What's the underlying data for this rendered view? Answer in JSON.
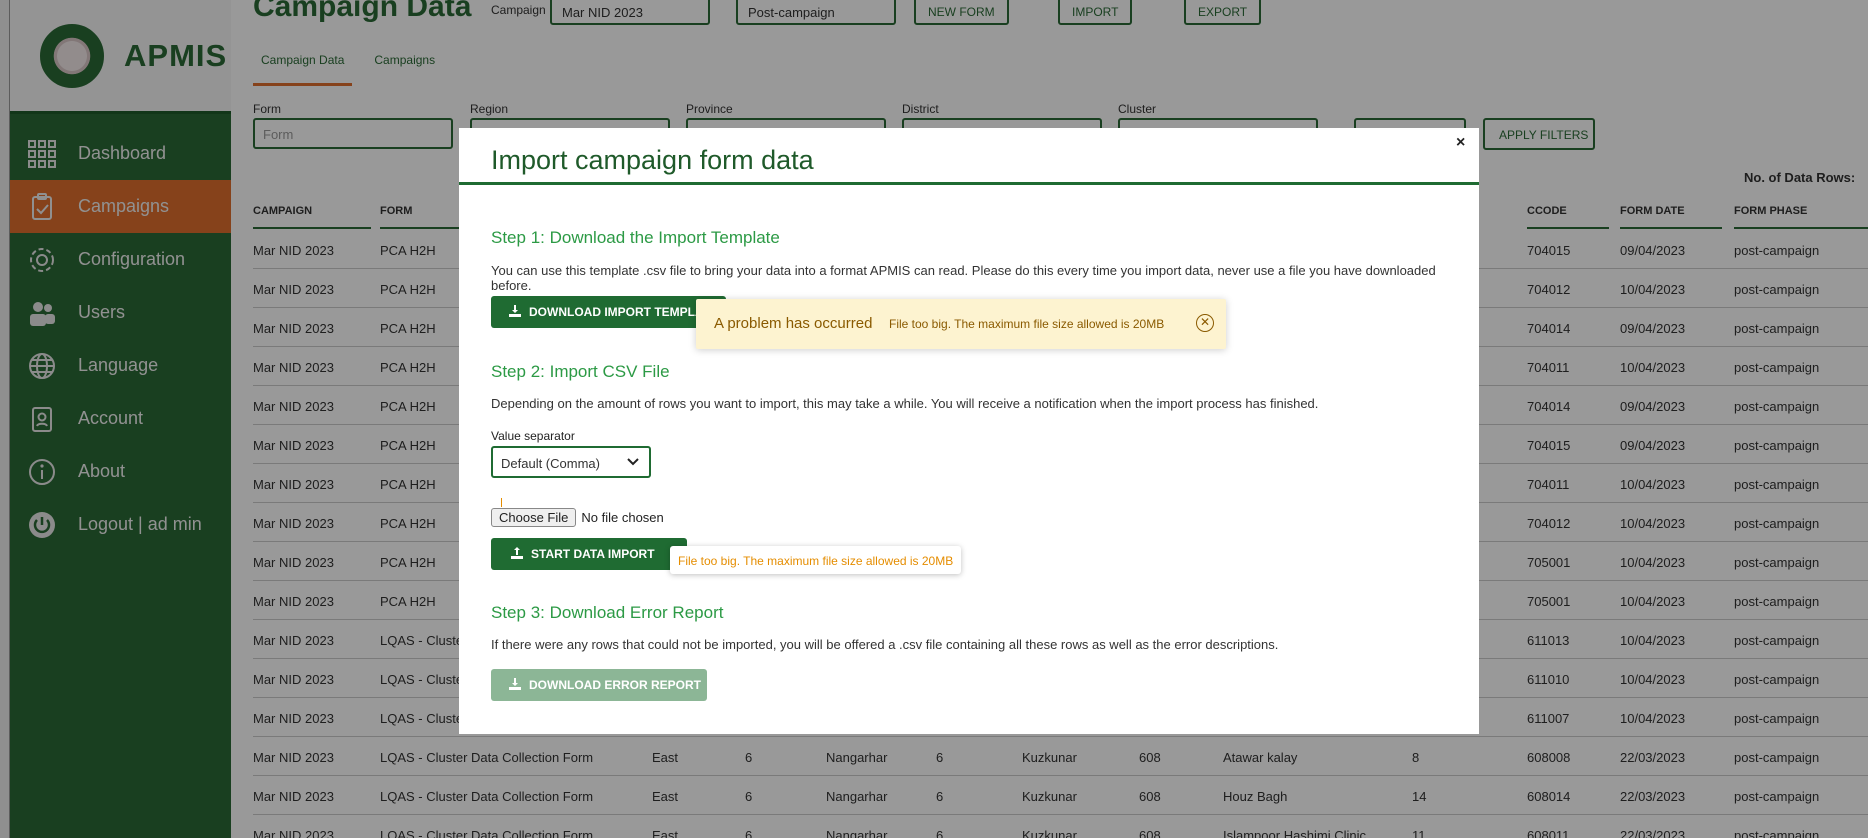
{
  "app": {
    "name": "APMIS"
  },
  "sidebar": {
    "items": [
      {
        "label": "Dashboard",
        "icon": "grid-icon"
      },
      {
        "label": "Campaigns",
        "icon": "clipboard-icon"
      },
      {
        "label": "Configuration",
        "icon": "gear-icon"
      },
      {
        "label": "Users",
        "icon": "users-icon"
      },
      {
        "label": "Language",
        "icon": "globe-icon"
      },
      {
        "label": "Account",
        "icon": "id-badge-icon"
      },
      {
        "label": "About",
        "icon": "info-icon"
      },
      {
        "label": "Logout | ad min",
        "icon": "power-icon"
      }
    ]
  },
  "header": {
    "title": "Campaign Data",
    "campaign_label": "Campaign",
    "campaign_value": "Mar NID 2023",
    "phase_value": "Post-campaign",
    "new_form": "NEW FORM",
    "import": "IMPORT",
    "export": "EXPORT"
  },
  "tabs": [
    "Campaign Data",
    "Campaigns"
  ],
  "filters": {
    "form_label": "Form",
    "form_placeholder": "Form",
    "region_label": "Region",
    "province_label": "Province",
    "district_label": "District",
    "cluster_label": "Cluster",
    "apply": "APPLY FILTERS",
    "rows_label": "No. of Data Rows:"
  },
  "table": {
    "headers": [
      "CAMPAIGN",
      "FORM",
      "CCODE",
      "FORM DATE",
      "FORM PHASE"
    ],
    "rows": [
      {
        "campaign": "Mar NID 2023",
        "form": "PCA H2H",
        "region": "",
        "rcode": "",
        "province": "",
        "pcode": "",
        "district": "",
        "dcode": "",
        "cluster": "",
        "clcode": "",
        "ccode": "704015",
        "date": "09/04/2023",
        "phase": "post-campaign"
      },
      {
        "campaign": "Mar NID 2023",
        "form": "PCA H2H",
        "region": "",
        "rcode": "",
        "province": "",
        "pcode": "",
        "district": "",
        "dcode": "",
        "cluster": "",
        "clcode": "",
        "ccode": "704012",
        "date": "10/04/2023",
        "phase": "post-campaign"
      },
      {
        "campaign": "Mar NID 2023",
        "form": "PCA H2H",
        "region": "",
        "rcode": "",
        "province": "",
        "pcode": "",
        "district": "",
        "dcode": "",
        "cluster": "",
        "clcode": "",
        "ccode": "704014",
        "date": "09/04/2023",
        "phase": "post-campaign"
      },
      {
        "campaign": "Mar NID 2023",
        "form": "PCA H2H",
        "region": "",
        "rcode": "",
        "province": "",
        "pcode": "",
        "district": "",
        "dcode": "",
        "cluster": "",
        "clcode": "",
        "ccode": "704011",
        "date": "10/04/2023",
        "phase": "post-campaign"
      },
      {
        "campaign": "Mar NID 2023",
        "form": "PCA H2H",
        "region": "",
        "rcode": "",
        "province": "",
        "pcode": "",
        "district": "",
        "dcode": "",
        "cluster": "",
        "clcode": "",
        "ccode": "704014",
        "date": "09/04/2023",
        "phase": "post-campaign"
      },
      {
        "campaign": "Mar NID 2023",
        "form": "PCA H2H",
        "region": "",
        "rcode": "",
        "province": "",
        "pcode": "",
        "district": "",
        "dcode": "",
        "cluster": "",
        "clcode": "",
        "ccode": "704015",
        "date": "09/04/2023",
        "phase": "post-campaign"
      },
      {
        "campaign": "Mar NID 2023",
        "form": "PCA H2H",
        "region": "",
        "rcode": "",
        "province": "",
        "pcode": "",
        "district": "",
        "dcode": "",
        "cluster": "",
        "clcode": "",
        "ccode": "704011",
        "date": "10/04/2023",
        "phase": "post-campaign"
      },
      {
        "campaign": "Mar NID 2023",
        "form": "PCA H2H",
        "region": "",
        "rcode": "",
        "province": "",
        "pcode": "",
        "district": "",
        "dcode": "",
        "cluster": "",
        "clcode": "",
        "ccode": "704012",
        "date": "10/04/2023",
        "phase": "post-campaign"
      },
      {
        "campaign": "Mar NID 2023",
        "form": "PCA H2H",
        "region": "",
        "rcode": "",
        "province": "",
        "pcode": "",
        "district": "",
        "dcode": "",
        "cluster": "",
        "clcode": "",
        "ccode": "705001",
        "date": "10/04/2023",
        "phase": "post-campaign"
      },
      {
        "campaign": "Mar NID 2023",
        "form": "PCA H2H",
        "region": "",
        "rcode": "",
        "province": "",
        "pcode": "",
        "district": "",
        "dcode": "",
        "cluster": "",
        "clcode": "",
        "ccode": "705001",
        "date": "10/04/2023",
        "phase": "post-campaign"
      },
      {
        "campaign": "Mar NID 2023",
        "form": "LQAS - Cluster",
        "region": "",
        "rcode": "",
        "province": "",
        "pcode": "",
        "district": "",
        "dcode": "",
        "cluster": "",
        "clcode": "",
        "ccode": "611013",
        "date": "10/04/2023",
        "phase": "post-campaign"
      },
      {
        "campaign": "Mar NID 2023",
        "form": "LQAS - Cluster",
        "region": "",
        "rcode": "",
        "province": "",
        "pcode": "",
        "district": "",
        "dcode": "",
        "cluster": "",
        "clcode": "",
        "ccode": "611010",
        "date": "10/04/2023",
        "phase": "post-campaign"
      },
      {
        "campaign": "Mar NID 2023",
        "form": "LQAS - Cluster",
        "region": "",
        "rcode": "",
        "province": "",
        "pcode": "",
        "district": "",
        "dcode": "",
        "cluster": "",
        "clcode": "",
        "ccode": "611007",
        "date": "10/04/2023",
        "phase": "post-campaign"
      },
      {
        "campaign": "Mar NID 2023",
        "form": "LQAS - Cluster Data Collection Form",
        "region": "East",
        "rcode": "6",
        "province": "Nangarhar",
        "pcode": "6",
        "district": "Kuzkunar",
        "dcode": "608",
        "cluster": "Atawar kalay",
        "clcode": "8",
        "ccode": "608008",
        "date": "22/03/2023",
        "phase": "post-campaign"
      },
      {
        "campaign": "Mar NID 2023",
        "form": "LQAS - Cluster Data Collection Form",
        "region": "East",
        "rcode": "6",
        "province": "Nangarhar",
        "pcode": "6",
        "district": "Kuzkunar",
        "dcode": "608",
        "cluster": "Houz Bagh",
        "clcode": "14",
        "ccode": "608014",
        "date": "22/03/2023",
        "phase": "post-campaign"
      },
      {
        "campaign": "Mar NID 2023",
        "form": "LQAS - Cluster Data Collection Form",
        "region": "East",
        "rcode": "6",
        "province": "Nangarhar",
        "pcode": "6",
        "district": "Kuzkunar",
        "dcode": "608",
        "cluster": "Islampoor Hashimi Clinic",
        "clcode": "11",
        "ccode": "608011",
        "date": "22/03/2023",
        "phase": "post-campaign"
      }
    ]
  },
  "modal": {
    "title": "Import campaign form data",
    "close": "×",
    "step1_heading": "Step 1: Download the Import Template",
    "step1_text": "You can use this template .csv file to bring your data into a format APMIS can read. Please do this every time you import data, never use a file you have downloaded before.",
    "download_template": "DOWNLOAD IMPORT TEMPLATE",
    "step2_heading": "Step 2: Import CSV File",
    "step2_text": "Depending on the amount of rows you want to import, this may take a while. You will receive a notification when the import process has finished.",
    "separator_label": "Value separator",
    "separator_value": "Default (Comma)",
    "choose_file": "Choose File",
    "no_file": "No file chosen",
    "start_import": "START DATA IMPORT",
    "file_error": "File too big. The maximum file size allowed is 20MB",
    "step3_heading": "Step 3: Download Error Report",
    "step3_text": "If there were any rows that could not be imported, you will be offered a .csv file containing all these rows as well as the error descriptions.",
    "download_error": "DOWNLOAD ERROR REPORT"
  },
  "alert": {
    "title": "A problem has occurred",
    "message": "File too big. The maximum file size allowed is 20MB"
  }
}
